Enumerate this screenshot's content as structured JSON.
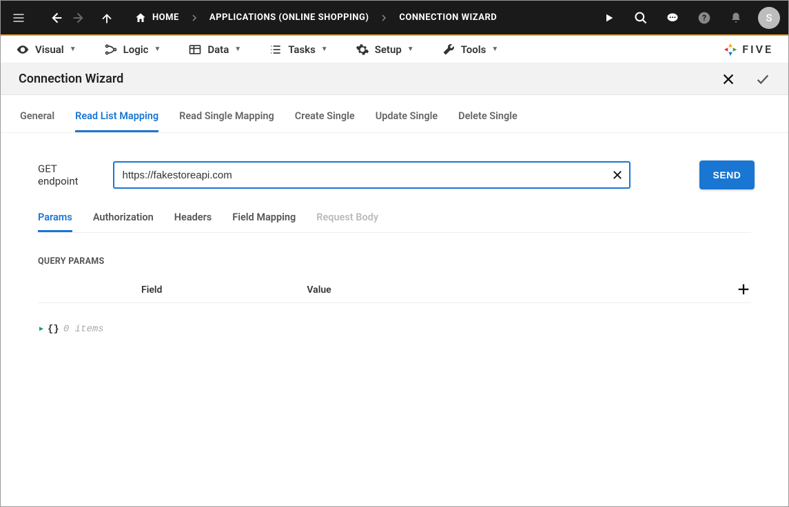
{
  "topbar": {
    "breadcrumbs": [
      {
        "label": "HOME"
      },
      {
        "label": "APPLICATIONS (ONLINE SHOPPING)"
      },
      {
        "label": "CONNECTION WIZARD"
      }
    ],
    "avatar_initial": "S"
  },
  "menubar": {
    "items": [
      {
        "label": "Visual"
      },
      {
        "label": "Logic"
      },
      {
        "label": "Data"
      },
      {
        "label": "Tasks"
      },
      {
        "label": "Setup"
      },
      {
        "label": "Tools"
      }
    ],
    "brand": "FIVE"
  },
  "titlebar": {
    "title": "Connection Wizard"
  },
  "main_tabs": [
    {
      "label": "General",
      "active": false
    },
    {
      "label": "Read List Mapping",
      "active": true
    },
    {
      "label": "Read Single Mapping",
      "active": false
    },
    {
      "label": "Create Single",
      "active": false
    },
    {
      "label": "Update Single",
      "active": false
    },
    {
      "label": "Delete Single",
      "active": false
    }
  ],
  "form": {
    "endpoint_label": "GET endpoint",
    "endpoint_value": "https://fakestoreapi.com",
    "send_label": "SEND"
  },
  "sub_tabs": [
    {
      "label": "Params",
      "active": true,
      "disabled": false
    },
    {
      "label": "Authorization",
      "active": false,
      "disabled": false
    },
    {
      "label": "Headers",
      "active": false,
      "disabled": false
    },
    {
      "label": "Field Mapping",
      "active": false,
      "disabled": false
    },
    {
      "label": "Request Body",
      "active": false,
      "disabled": true
    }
  ],
  "params": {
    "section_title": "QUERY PARAMS",
    "col_field": "Field",
    "col_value": "Value"
  },
  "json": {
    "braces": "{}",
    "items_text": "0 items"
  }
}
